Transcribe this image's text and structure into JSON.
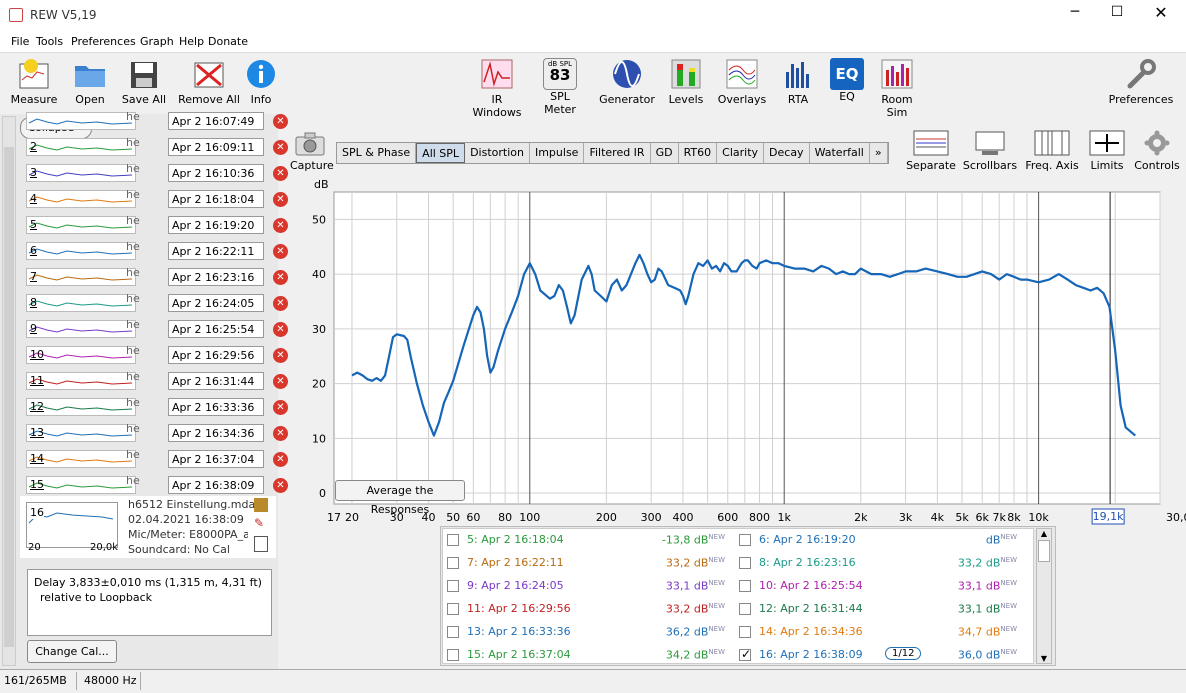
{
  "window": {
    "title": "REW V5,19"
  },
  "menu": [
    "File",
    "Tools",
    "Preferences",
    "Graph",
    "Help",
    "Donate"
  ],
  "toolbar_left": [
    {
      "label": "Measure",
      "icon": "measure-icon"
    },
    {
      "label": "Open",
      "icon": "folder-icon"
    },
    {
      "label": "Save All",
      "icon": "save-icon"
    },
    {
      "label": "Remove All",
      "icon": "remove-all-icon"
    },
    {
      "label": "Info",
      "icon": "info-icon"
    }
  ],
  "toolbar_mid": [
    {
      "label": "IR Windows",
      "icon": "ir-windows-icon"
    },
    {
      "label": "SPL Meter",
      "icon": "spl-meter-icon",
      "badge_top": "dB SPL",
      "badge_val": "83"
    },
    {
      "label": "Generator",
      "icon": "generator-icon"
    },
    {
      "label": "Levels",
      "icon": "levels-icon"
    },
    {
      "label": "Overlays",
      "icon": "overlays-icon"
    },
    {
      "label": "RTA",
      "icon": "rta-icon"
    },
    {
      "label": "EQ",
      "icon": "eq-icon",
      "badge_val": "EQ"
    },
    {
      "label": "Room Sim",
      "icon": "room-sim-icon"
    }
  ],
  "toolbar_right": {
    "label": "Preferences",
    "icon": "wrench-icon"
  },
  "collapse_label": "Collapse",
  "capture_label": "Capture",
  "graph_tabs": [
    "SPL & Phase",
    "All SPL",
    "Distortion",
    "Impulse",
    "Filtered IR",
    "GD",
    "RT60",
    "Clarity",
    "Decay",
    "Waterfall",
    "»"
  ],
  "selected_tab": "All SPL",
  "graph_tools": [
    {
      "label": "Separate",
      "icon": "separate-icon"
    },
    {
      "label": "Scrollbars",
      "icon": "scrollbars-icon"
    },
    {
      "label": "Freq. Axis",
      "icon": "freq-axis-icon"
    },
    {
      "label": "Limits",
      "icon": "limits-icon"
    },
    {
      "label": "Controls",
      "icon": "controls-gear-icon"
    }
  ],
  "measurements": [
    {
      "num": "",
      "name": "Apr 2 16:07:49",
      "color": "#1f6fb5"
    },
    {
      "num": "2",
      "name": "Apr 2 16:09:11",
      "color": "#2a9a3a"
    },
    {
      "num": "3",
      "name": "Apr 2 16:10:36",
      "color": "#4040c0"
    },
    {
      "num": "4",
      "name": "Apr 2 16:18:04",
      "color": "#e07a10"
    },
    {
      "num": "5",
      "name": "Apr 2 16:19:20",
      "color": "#2a9a3a"
    },
    {
      "num": "6",
      "name": "Apr 2 16:22:11",
      "color": "#1f6fb5"
    },
    {
      "num": "7",
      "name": "Apr 2 16:23:16",
      "color": "#b86a10"
    },
    {
      "num": "8",
      "name": "Apr 2 16:24:05",
      "color": "#1a9a8a"
    },
    {
      "num": "9",
      "name": "Apr 2 16:25:54",
      "color": "#7a3ac8"
    },
    {
      "num": "10",
      "name": "Apr 2 16:29:56",
      "color": "#b020b0"
    },
    {
      "num": "11",
      "name": "Apr 2 16:31:44",
      "color": "#c02020"
    },
    {
      "num": "12",
      "name": "Apr 2 16:33:36",
      "color": "#1a7a4a"
    },
    {
      "num": "13",
      "name": "Apr 2 16:34:36",
      "color": "#1f6fb5"
    },
    {
      "num": "14",
      "name": "Apr 2 16:37:04",
      "color": "#e07a10"
    },
    {
      "num": "15",
      "name": "Apr 2 16:38:09",
      "color": "#2a9a3a"
    }
  ],
  "meas_prefix": "he",
  "details": {
    "num": "16",
    "file": "h6512 Einstellung.mdat",
    "date": "02.04.2021 16:38:09",
    "mic": "Mic/Meter: E8000PA_alle",
    "soundcard": "Soundcard: No Cal",
    "thumb_left": "20",
    "thumb_right": "20,0k"
  },
  "delay_line1": "Delay 3,833±0,010 ms (1,315 m, 4,31 ft)",
  "delay_line2": "relative to Loopback",
  "change_cal_label": "Change Cal...",
  "avg_button_label": "Average the Responses",
  "chart_data": {
    "type": "line",
    "ylabel": "dB",
    "ylim": [
      -2,
      55
    ],
    "xlim": [
      17,
      30000
    ],
    "xscale": "log",
    "y_ticks": [
      "50",
      "40",
      "30",
      "20",
      "10",
      "0"
    ],
    "x_tick_labels": [
      "17",
      "20",
      "30",
      "40",
      "50",
      "60",
      "80",
      "100",
      "200",
      "300",
      "400",
      "600",
      "800",
      "1k",
      "2k",
      "3k",
      "4k",
      "5k",
      "6k",
      "7k",
      "8k",
      "10k",
      "30,0kHz"
    ],
    "cursor_label": "19,1k",
    "cursor_x": 19100,
    "series": [
      {
        "color": "#1565b8",
        "points": [
          [
            20,
            21.5
          ],
          [
            21,
            22
          ],
          [
            22,
            21.5
          ],
          [
            23,
            20.8
          ],
          [
            24,
            20.5
          ],
          [
            25,
            21
          ],
          [
            26,
            20.5
          ],
          [
            27,
            21.5
          ],
          [
            28,
            25
          ],
          [
            29,
            28.5
          ],
          [
            30,
            29
          ],
          [
            32,
            28.7
          ],
          [
            33,
            28
          ],
          [
            34,
            25
          ],
          [
            36,
            20
          ],
          [
            38,
            16
          ],
          [
            40,
            13
          ],
          [
            42,
            10.5
          ],
          [
            44,
            13
          ],
          [
            46,
            16.5
          ],
          [
            48,
            18.5
          ],
          [
            50,
            20.5
          ],
          [
            55,
            27
          ],
          [
            60,
            32.5
          ],
          [
            62,
            34
          ],
          [
            64,
            33
          ],
          [
            66,
            30
          ],
          [
            68,
            25
          ],
          [
            70,
            22
          ],
          [
            72,
            23
          ],
          [
            75,
            26
          ],
          [
            80,
            30
          ],
          [
            85,
            33
          ],
          [
            90,
            36
          ],
          [
            95,
            40
          ],
          [
            100,
            42
          ],
          [
            105,
            40
          ],
          [
            110,
            37
          ],
          [
            120,
            35.5
          ],
          [
            125,
            36
          ],
          [
            130,
            38
          ],
          [
            135,
            37
          ],
          [
            140,
            34
          ],
          [
            145,
            31
          ],
          [
            150,
            32.5
          ],
          [
            160,
            39
          ],
          [
            170,
            41.5
          ],
          [
            175,
            40
          ],
          [
            180,
            37
          ],
          [
            190,
            36
          ],
          [
            200,
            35
          ],
          [
            210,
            38
          ],
          [
            220,
            39
          ],
          [
            230,
            37
          ],
          [
            240,
            38
          ],
          [
            250,
            40
          ],
          [
            260,
            42
          ],
          [
            270,
            43.5
          ],
          [
            280,
            42
          ],
          [
            290,
            40
          ],
          [
            300,
            38.5
          ],
          [
            310,
            39
          ],
          [
            320,
            41
          ],
          [
            330,
            40.5
          ],
          [
            350,
            38
          ],
          [
            370,
            37.5
          ],
          [
            390,
            37
          ],
          [
            400,
            36
          ],
          [
            410,
            34.5
          ],
          [
            420,
            36
          ],
          [
            440,
            40
          ],
          [
            460,
            42
          ],
          [
            480,
            41.5
          ],
          [
            500,
            42.5
          ],
          [
            520,
            41
          ],
          [
            540,
            41.5
          ],
          [
            560,
            40.5
          ],
          [
            580,
            42
          ],
          [
            600,
            41.5
          ],
          [
            620,
            40.5
          ],
          [
            650,
            40.5
          ],
          [
            680,
            42
          ],
          [
            700,
            42.5
          ],
          [
            720,
            42.5
          ],
          [
            750,
            41.5
          ],
          [
            780,
            41
          ],
          [
            800,
            42
          ],
          [
            850,
            42.5
          ],
          [
            900,
            42
          ],
          [
            950,
            42
          ],
          [
            1000,
            41.5
          ],
          [
            1100,
            41
          ],
          [
            1200,
            41
          ],
          [
            1300,
            40.5
          ],
          [
            1400,
            41.5
          ],
          [
            1500,
            41
          ],
          [
            1600,
            40
          ],
          [
            1700,
            40.5
          ],
          [
            1800,
            40
          ],
          [
            1900,
            40
          ],
          [
            2000,
            41
          ],
          [
            2200,
            40
          ],
          [
            2400,
            40
          ],
          [
            2600,
            39.5
          ],
          [
            2800,
            40
          ],
          [
            3000,
            40.5
          ],
          [
            3300,
            40.5
          ],
          [
            3600,
            41
          ],
          [
            4000,
            40.5
          ],
          [
            4400,
            40
          ],
          [
            4800,
            39.5
          ],
          [
            5200,
            39.5
          ],
          [
            5600,
            40
          ],
          [
            6000,
            40.5
          ],
          [
            6500,
            40
          ],
          [
            7000,
            39
          ],
          [
            7500,
            40
          ],
          [
            8000,
            39.5
          ],
          [
            8500,
            39
          ],
          [
            9000,
            39
          ],
          [
            10000,
            38.5
          ],
          [
            11000,
            39
          ],
          [
            12000,
            40
          ],
          [
            13000,
            39
          ],
          [
            14000,
            38
          ],
          [
            15000,
            37.5
          ],
          [
            16000,
            37
          ],
          [
            17000,
            37.5
          ],
          [
            18000,
            36.5
          ],
          [
            19000,
            34
          ],
          [
            20000,
            26
          ],
          [
            21000,
            16
          ],
          [
            22000,
            12
          ],
          [
            24000,
            10.5
          ]
        ]
      }
    ]
  },
  "legend": [
    {
      "label": "5: Apr 2 16:18:04",
      "value": "-13,8 dB",
      "color": "#2a9a3a",
      "checked": false
    },
    {
      "label": "6: Apr 2 16:19:20",
      "value": "dB",
      "color": "#1f6fb5",
      "checked": false
    },
    {
      "label": "7: Apr 2 16:22:11",
      "value": "33,2 dB",
      "color": "#b86a10",
      "checked": false
    },
    {
      "label": "8: Apr 2 16:23:16",
      "value": "33,2 dB",
      "color": "#1a9a8a",
      "checked": false
    },
    {
      "label": "9: Apr 2 16:24:05",
      "value": "33,1 dB",
      "color": "#7a3ac8",
      "checked": false
    },
    {
      "label": "10: Apr 2 16:25:54",
      "value": "33,1 dB",
      "color": "#b020b0",
      "checked": false
    },
    {
      "label": "11: Apr 2 16:29:56",
      "value": "33,2 dB",
      "color": "#c02020",
      "checked": false
    },
    {
      "label": "12: Apr 2 16:31:44",
      "value": "33,1 dB",
      "color": "#1a7a4a",
      "checked": false
    },
    {
      "label": "13: Apr 2 16:33:36",
      "value": "36,2 dB",
      "color": "#1f6fb5",
      "checked": false
    },
    {
      "label": "14: Apr 2 16:34:36",
      "value": "34,7 dB",
      "color": "#e07a10",
      "checked": false
    },
    {
      "label": "15: Apr 2 16:37:04",
      "value": "34,2 dB",
      "color": "#2a9a3a",
      "checked": false
    },
    {
      "label": "16: Apr 2 16:38:09",
      "value": "36,0 dB",
      "color": "#1f6fb5",
      "checked": true,
      "smoothing": "1/12"
    }
  ],
  "legend_new": "NEW",
  "status": {
    "memory": "161/265MB",
    "rate": "48000 Hz"
  }
}
